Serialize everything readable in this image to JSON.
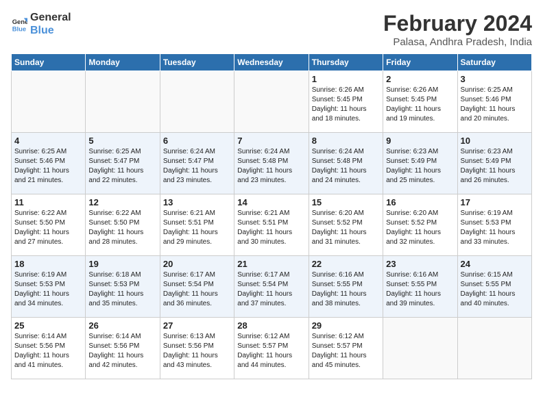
{
  "header": {
    "logo_line1": "General",
    "logo_line2": "Blue",
    "month_title": "February 2024",
    "location": "Palasa, Andhra Pradesh, India"
  },
  "weekdays": [
    "Sunday",
    "Monday",
    "Tuesday",
    "Wednesday",
    "Thursday",
    "Friday",
    "Saturday"
  ],
  "weeks": [
    [
      {
        "day": "",
        "info": "",
        "empty": true
      },
      {
        "day": "",
        "info": "",
        "empty": true
      },
      {
        "day": "",
        "info": "",
        "empty": true
      },
      {
        "day": "",
        "info": "",
        "empty": true
      },
      {
        "day": "1",
        "info": "Sunrise: 6:26 AM\nSunset: 5:45 PM\nDaylight: 11 hours\nand 18 minutes.",
        "empty": false
      },
      {
        "day": "2",
        "info": "Sunrise: 6:26 AM\nSunset: 5:45 PM\nDaylight: 11 hours\nand 19 minutes.",
        "empty": false
      },
      {
        "day": "3",
        "info": "Sunrise: 6:25 AM\nSunset: 5:46 PM\nDaylight: 11 hours\nand 20 minutes.",
        "empty": false
      }
    ],
    [
      {
        "day": "4",
        "info": "Sunrise: 6:25 AM\nSunset: 5:46 PM\nDaylight: 11 hours\nand 21 minutes.",
        "empty": false
      },
      {
        "day": "5",
        "info": "Sunrise: 6:25 AM\nSunset: 5:47 PM\nDaylight: 11 hours\nand 22 minutes.",
        "empty": false
      },
      {
        "day": "6",
        "info": "Sunrise: 6:24 AM\nSunset: 5:47 PM\nDaylight: 11 hours\nand 23 minutes.",
        "empty": false
      },
      {
        "day": "7",
        "info": "Sunrise: 6:24 AM\nSunset: 5:48 PM\nDaylight: 11 hours\nand 23 minutes.",
        "empty": false
      },
      {
        "day": "8",
        "info": "Sunrise: 6:24 AM\nSunset: 5:48 PM\nDaylight: 11 hours\nand 24 minutes.",
        "empty": false
      },
      {
        "day": "9",
        "info": "Sunrise: 6:23 AM\nSunset: 5:49 PM\nDaylight: 11 hours\nand 25 minutes.",
        "empty": false
      },
      {
        "day": "10",
        "info": "Sunrise: 6:23 AM\nSunset: 5:49 PM\nDaylight: 11 hours\nand 26 minutes.",
        "empty": false
      }
    ],
    [
      {
        "day": "11",
        "info": "Sunrise: 6:22 AM\nSunset: 5:50 PM\nDaylight: 11 hours\nand 27 minutes.",
        "empty": false
      },
      {
        "day": "12",
        "info": "Sunrise: 6:22 AM\nSunset: 5:50 PM\nDaylight: 11 hours\nand 28 minutes.",
        "empty": false
      },
      {
        "day": "13",
        "info": "Sunrise: 6:21 AM\nSunset: 5:51 PM\nDaylight: 11 hours\nand 29 minutes.",
        "empty": false
      },
      {
        "day": "14",
        "info": "Sunrise: 6:21 AM\nSunset: 5:51 PM\nDaylight: 11 hours\nand 30 minutes.",
        "empty": false
      },
      {
        "day": "15",
        "info": "Sunrise: 6:20 AM\nSunset: 5:52 PM\nDaylight: 11 hours\nand 31 minutes.",
        "empty": false
      },
      {
        "day": "16",
        "info": "Sunrise: 6:20 AM\nSunset: 5:52 PM\nDaylight: 11 hours\nand 32 minutes.",
        "empty": false
      },
      {
        "day": "17",
        "info": "Sunrise: 6:19 AM\nSunset: 5:53 PM\nDaylight: 11 hours\nand 33 minutes.",
        "empty": false
      }
    ],
    [
      {
        "day": "18",
        "info": "Sunrise: 6:19 AM\nSunset: 5:53 PM\nDaylight: 11 hours\nand 34 minutes.",
        "empty": false
      },
      {
        "day": "19",
        "info": "Sunrise: 6:18 AM\nSunset: 5:53 PM\nDaylight: 11 hours\nand 35 minutes.",
        "empty": false
      },
      {
        "day": "20",
        "info": "Sunrise: 6:17 AM\nSunset: 5:54 PM\nDaylight: 11 hours\nand 36 minutes.",
        "empty": false
      },
      {
        "day": "21",
        "info": "Sunrise: 6:17 AM\nSunset: 5:54 PM\nDaylight: 11 hours\nand 37 minutes.",
        "empty": false
      },
      {
        "day": "22",
        "info": "Sunrise: 6:16 AM\nSunset: 5:55 PM\nDaylight: 11 hours\nand 38 minutes.",
        "empty": false
      },
      {
        "day": "23",
        "info": "Sunrise: 6:16 AM\nSunset: 5:55 PM\nDaylight: 11 hours\nand 39 minutes.",
        "empty": false
      },
      {
        "day": "24",
        "info": "Sunrise: 6:15 AM\nSunset: 5:55 PM\nDaylight: 11 hours\nand 40 minutes.",
        "empty": false
      }
    ],
    [
      {
        "day": "25",
        "info": "Sunrise: 6:14 AM\nSunset: 5:56 PM\nDaylight: 11 hours\nand 41 minutes.",
        "empty": false
      },
      {
        "day": "26",
        "info": "Sunrise: 6:14 AM\nSunset: 5:56 PM\nDaylight: 11 hours\nand 42 minutes.",
        "empty": false
      },
      {
        "day": "27",
        "info": "Sunrise: 6:13 AM\nSunset: 5:56 PM\nDaylight: 11 hours\nand 43 minutes.",
        "empty": false
      },
      {
        "day": "28",
        "info": "Sunrise: 6:12 AM\nSunset: 5:57 PM\nDaylight: 11 hours\nand 44 minutes.",
        "empty": false
      },
      {
        "day": "29",
        "info": "Sunrise: 6:12 AM\nSunset: 5:57 PM\nDaylight: 11 hours\nand 45 minutes.",
        "empty": false
      },
      {
        "day": "",
        "info": "",
        "empty": true
      },
      {
        "day": "",
        "info": "",
        "empty": true
      }
    ]
  ]
}
